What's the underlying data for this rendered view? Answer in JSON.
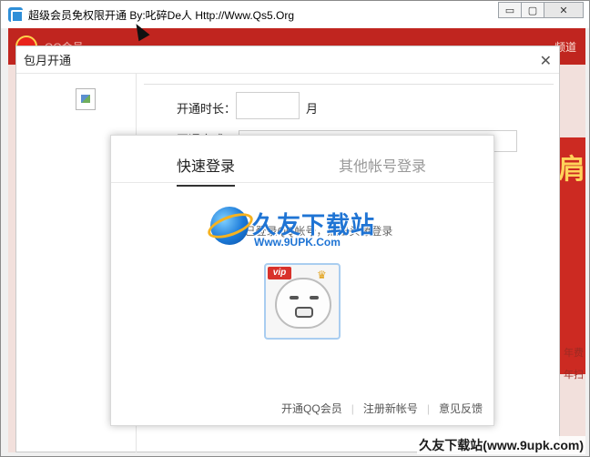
{
  "window": {
    "title": "超级会员免权限开通   By:叱碎De人   Http://Www.Qs5.Org",
    "minimize_glyph": "▭",
    "maximize_glyph": "▢",
    "close_glyph": "✕"
  },
  "background_app": {
    "topbar_label": "QQ会员",
    "topbar_right": "频道",
    "banner_glyph": "肩",
    "side_text_1": "年费",
    "side_text_2": "年扫"
  },
  "inner_dialog": {
    "title": "包月开通",
    "close_glyph": "✕",
    "duration_label": "开通时长：",
    "duration_value": "",
    "duration_unit": "月",
    "method_label": "开通方式"
  },
  "login": {
    "tab_quick": "快速登录",
    "tab_other": "其他帐号登录",
    "hint": "检测到已登录QQ帐号，点击头像登录",
    "vip_badge": "vip",
    "links": [
      "开通QQ会员",
      "注册新帐号",
      "意见反馈"
    ]
  },
  "watermark": {
    "title": "久友下载站",
    "url": "Www.9UPK.Com",
    "bottom": "久友下载站(www.9upk.com)"
  },
  "colors": {
    "qq_red": "#c0251f",
    "link_blue": "#1f74d4"
  }
}
